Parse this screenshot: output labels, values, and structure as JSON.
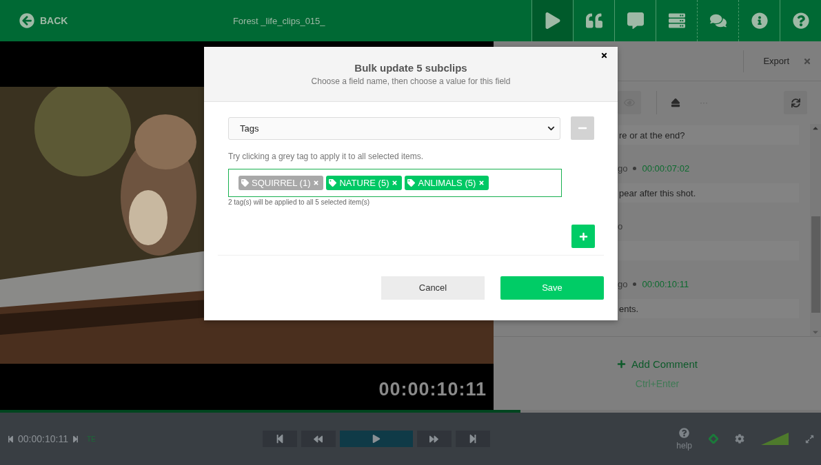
{
  "header": {
    "back": "BACK",
    "title": "Forest _life_clips_015_",
    "tools": [
      {
        "kind": "play",
        "selected": true
      },
      {
        "kind": "quote",
        "selected": false
      },
      {
        "kind": "comment",
        "selected": false
      },
      {
        "kind": "list",
        "selected": false
      },
      {
        "kind": "comments",
        "selected": false
      },
      {
        "kind": "info",
        "selected": false
      },
      {
        "kind": "help",
        "selected": false
      }
    ]
  },
  "video": {
    "kind": "picture",
    "timecode": "00:00:10:11"
  },
  "panel": {
    "export": "Export",
    "more": "···",
    "comments": [
      {
        "text": "re or at the end?"
      },
      {
        "meta": "go",
        "time": "00:00:07:02",
        "text": "pear after this shot."
      },
      {
        "meta": "o"
      },
      {
        "meta": "go",
        "time": "00:00:10:11",
        "text": "ents."
      }
    ],
    "add_comment": "Add Comment",
    "shortcut": "Ctrl+Enter"
  },
  "modal": {
    "title": "Bulk update 5 subclips",
    "subtitle": "Choose a field name, then choose a value for this field",
    "field": "Tags",
    "hint": "Try clicking a grey tag to apply it to all selected items.",
    "tags": [
      {
        "label": "SQUIRREL (1)",
        "applied": false
      },
      {
        "label": "NATURE (5)",
        "applied": true
      },
      {
        "label": "ANLIMALS (5)",
        "applied": true
      }
    ],
    "note": "2 tag(s) will be applied to all 5 selected item(s)",
    "cancel": "Cancel",
    "save": "Save"
  },
  "player": {
    "progress": {
      "level": 0.634
    },
    "timecode": "00:00:10:11",
    "badge": "TE",
    "help": "help"
  }
}
